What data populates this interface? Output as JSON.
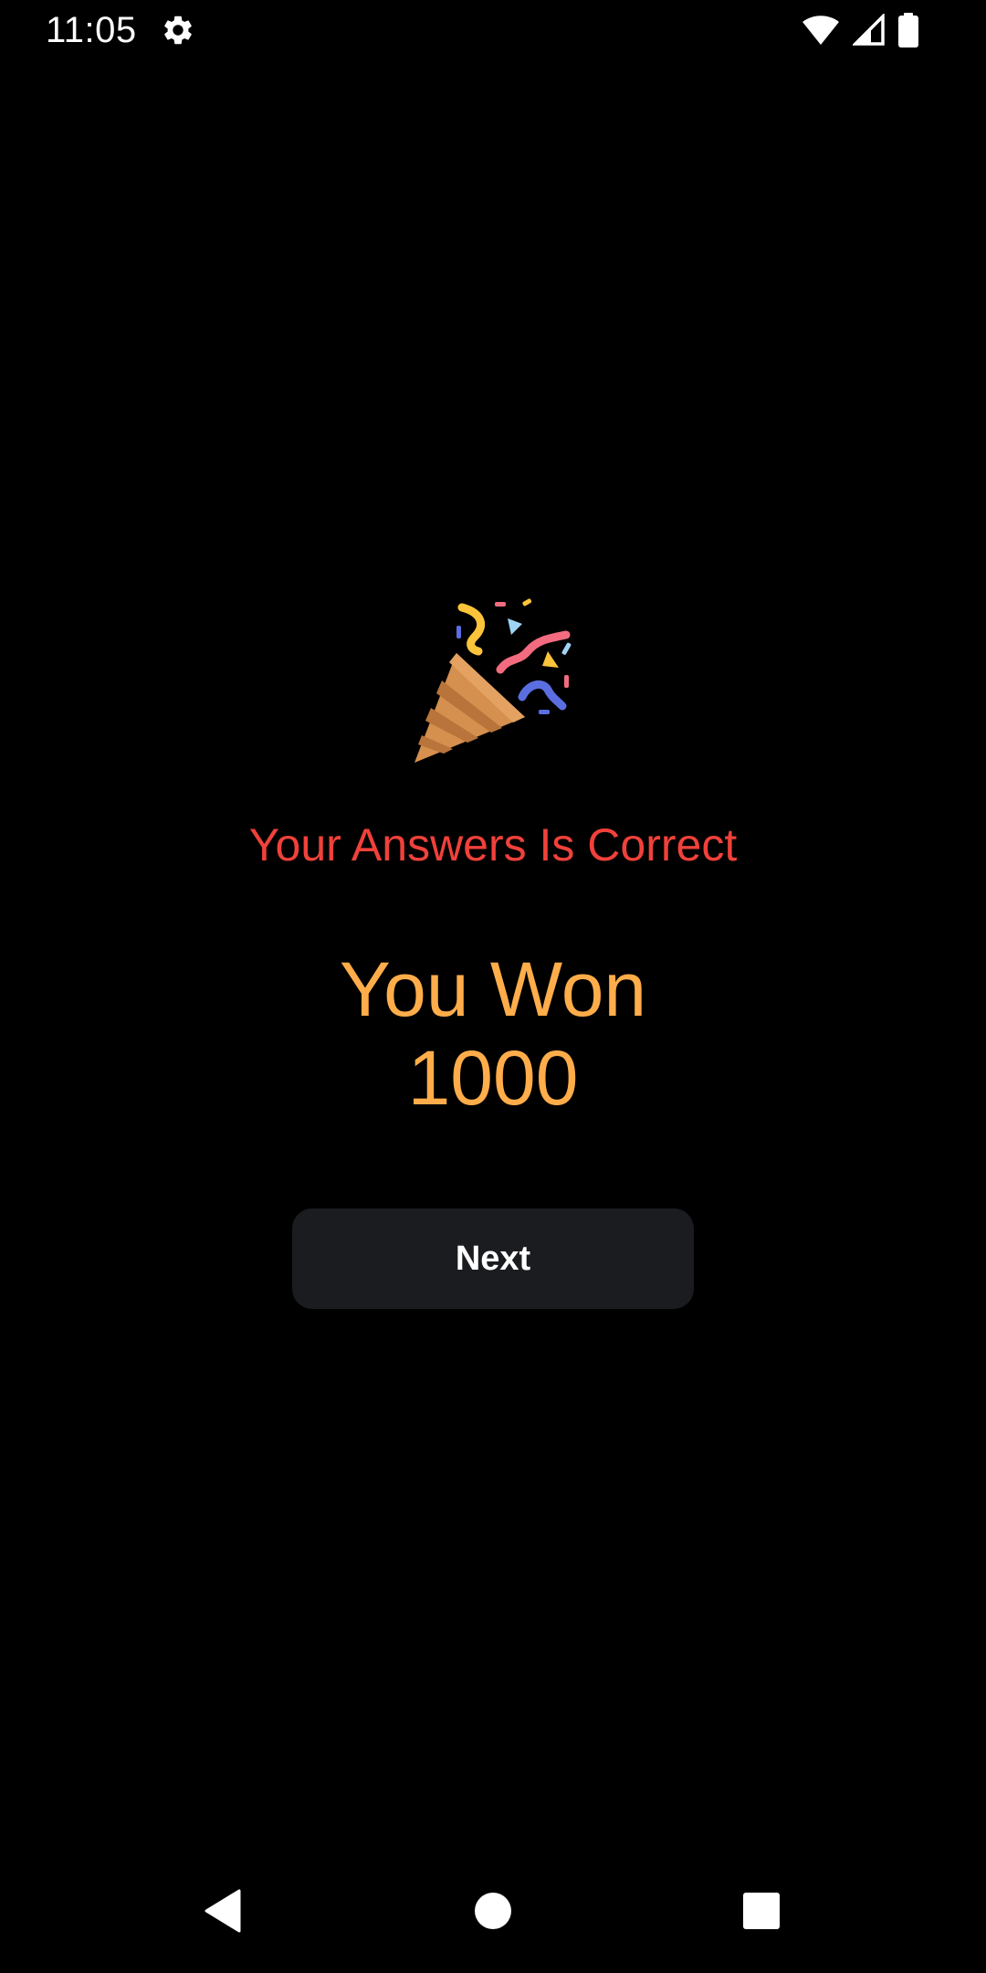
{
  "status_bar": {
    "time": "11:05",
    "icons": [
      "gear-icon",
      "wifi-icon",
      "signal-icon",
      "battery-icon"
    ]
  },
  "result": {
    "icon": "party-popper-icon",
    "message": "Your Answers Is Correct",
    "won_label": "You Won",
    "won_amount": "1000"
  },
  "actions": {
    "next_label": "Next"
  },
  "nav_bar": {
    "icons": [
      "back-icon",
      "home-icon",
      "recents-icon"
    ]
  },
  "colors": {
    "background": "#000000",
    "message": "#f0413a",
    "prize": "#ffad4a",
    "button_bg": "#1b1c20",
    "button_text": "#ffffff"
  }
}
